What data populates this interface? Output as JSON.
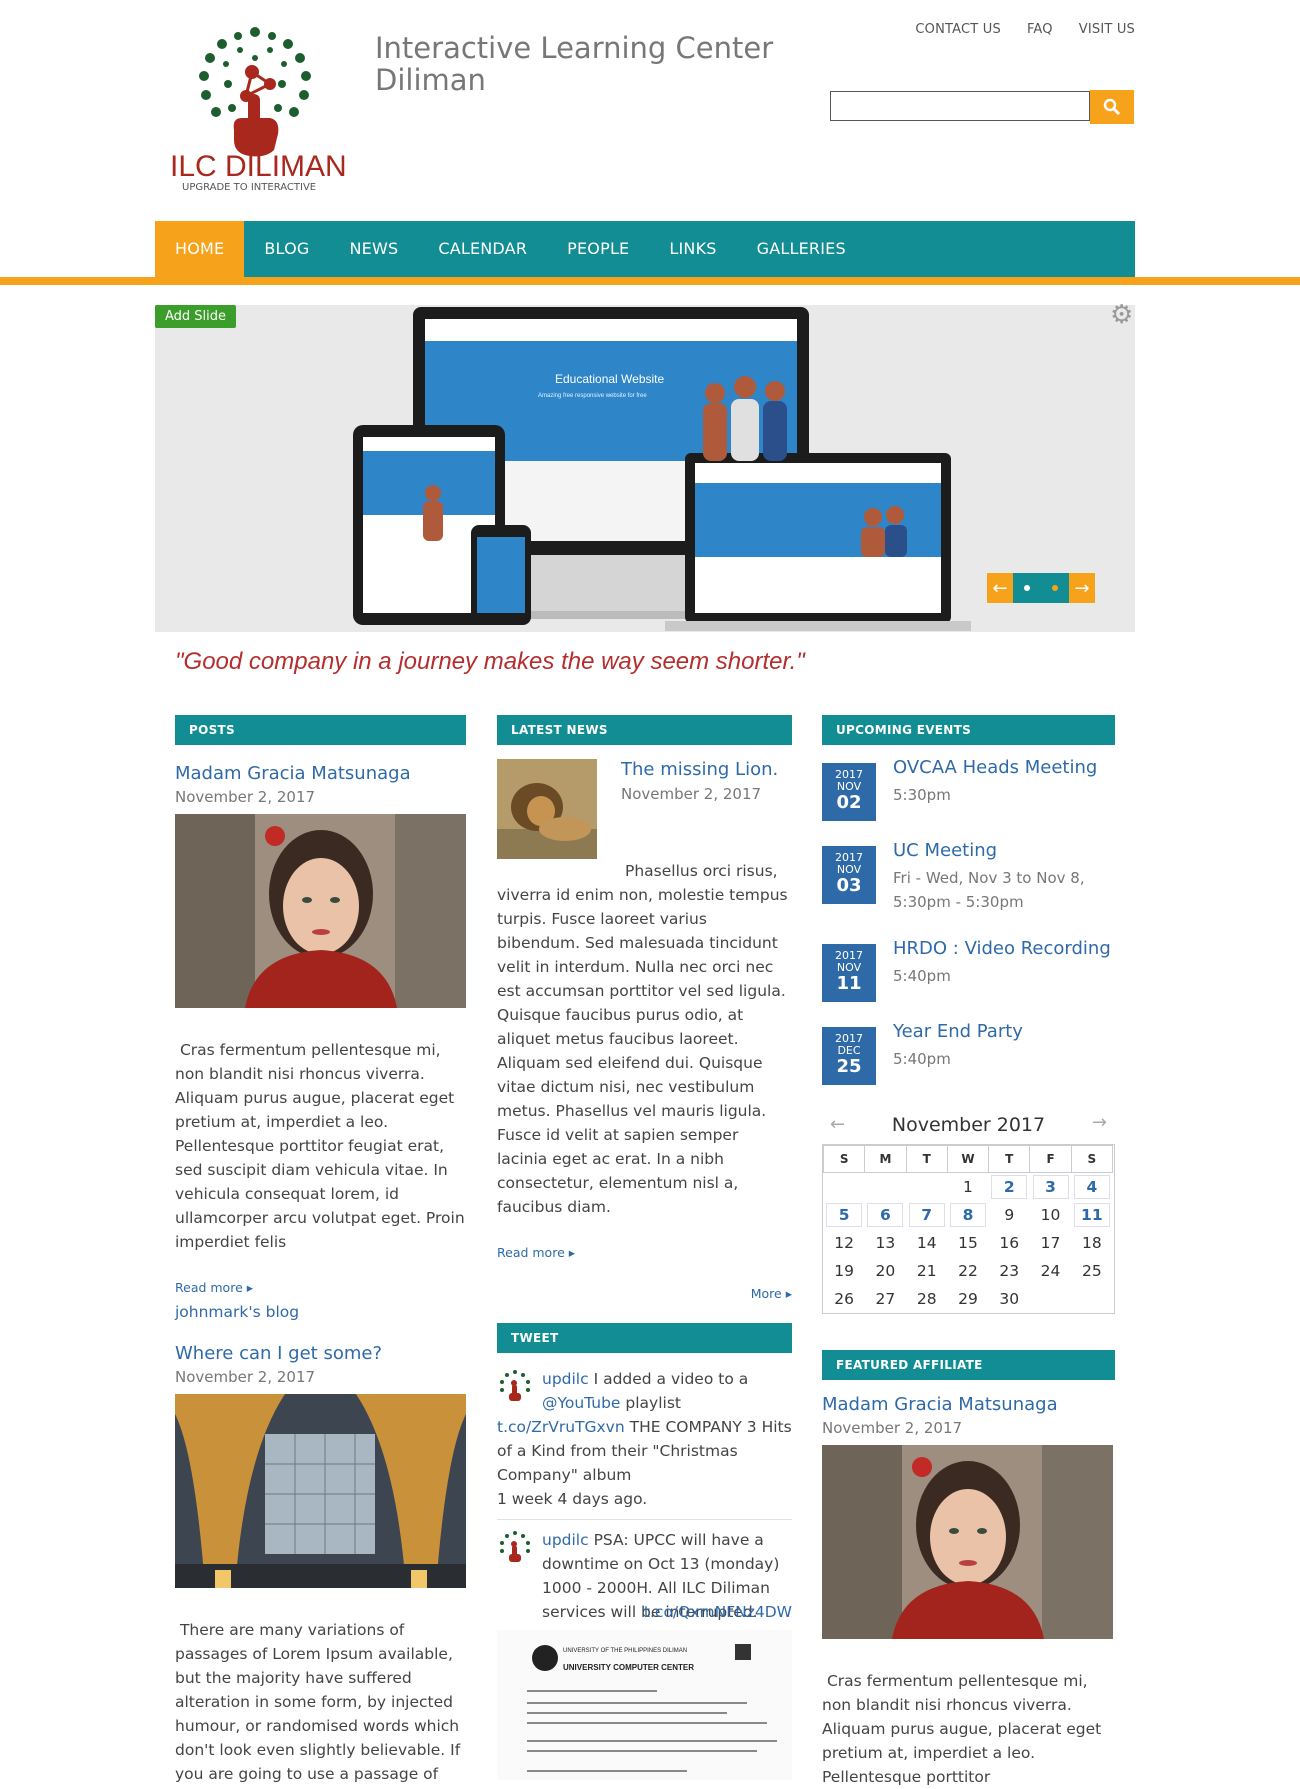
{
  "site": {
    "logo_text": "ILC DILIMAN",
    "logo_tagline": "UPGRADE TO INTERACTIVE",
    "title_line1": "Interactive Learning Center",
    "title_line2": "Diliman"
  },
  "toplinks": [
    "CONTACT US",
    "FAQ",
    "VISIT US"
  ],
  "search": {
    "placeholder": ""
  },
  "nav": [
    "HOME",
    "BLOG",
    "NEWS",
    "CALENDAR",
    "PEOPLE",
    "LINKS",
    "GALLERIES"
  ],
  "slider": {
    "add_slide": "Add Slide",
    "screen_title": "Educational Website",
    "screen_sub": "Amazing free responsive website for free"
  },
  "quote": {
    "text": "Good company in a journey makes the way seem shorter."
  },
  "posts": {
    "heading": "POSTS",
    "items": [
      {
        "title": "Madam Gracia Matsunaga",
        "date": "November 2, 2017",
        "text": "Cras fermentum pellentesque mi, non blandit nisi rhoncus viverra. Aliquam purus augue, placerat eget pretium at, imperdiet a leo. Pellentesque porttitor feugiat erat, sed suscipit diam vehicula vitae. In vehicula consequat lorem, id ullamcorper arcu volutpat eget. Proin imperdiet felis",
        "readmore": "Read more",
        "blog": "johnmark's blog"
      },
      {
        "title": "Where can I get some?",
        "date": "November 2, 2017",
        "text": "There are many variations of passages of Lorem Ipsum available, but the majority have suffered alteration in some form, by injected humour, or randomised words which don't look even slightly believable. If you are going to use a passage of"
      }
    ]
  },
  "news": {
    "heading": "LATEST NEWS",
    "title": "The missing Lion.",
    "date": "November 2, 2017",
    "text": "Phasellus orci risus, viverra id enim non, molestie tempus turpis. Fusce laoreet varius bibendum. Sed malesuada tincidunt velit in interdum. Nulla nec orci nec est accumsan porttitor vel sed ligula. Quisque faucibus purus odio, at aliquet metus faucibus laoreet. Aliquam sed eleifend dui. Quisque vitae dictum nisi, nec vestibulum metus. Phasellus vel mauris ligula. Fusce id velit at sapien semper lacinia eget ac erat. In a nibh consectetur, elementum nisl a, faucibus diam.",
    "readmore": "Read more",
    "more": "More"
  },
  "tweet": {
    "heading": "TWEET",
    "items": [
      {
        "user": "updilc",
        "text1": "I added a video to a",
        "mention": "@YouTube",
        "text2": "playlist",
        "link": "t.co/ZrVruTGxvn",
        "text3": "THE COMPANY 3 Hits of a Kind from their \"Christmas Company\" album",
        "ago": "1 week 4 days ago."
      },
      {
        "user": "updilc",
        "text1": "PSA: UPCC will have a downtime on Oct 13 (monday) 1000 - 2000H. All ILC Diliman services will be interrupted.",
        "link": "t.co/QxmNFNz4DW",
        "doc_header": "UNIVERSITY OF THE PHILIPPINES DILIMAN",
        "doc_center": "UNIVERSITY COMPUTER CENTER"
      }
    ]
  },
  "events": {
    "heading": "UPCOMING EVENTS",
    "items": [
      {
        "year": "2017",
        "month": "NOV",
        "day": "02",
        "title": "OVCAA Heads Meeting",
        "time": "5:30pm"
      },
      {
        "year": "2017",
        "month": "NOV",
        "day": "03",
        "title": "UC Meeting",
        "time": "Fri - Wed, Nov 3 to Nov 8, 5:30pm - 5:30pm"
      },
      {
        "year": "2017",
        "month": "NOV",
        "day": "11",
        "title": "HRDO : Video Recording",
        "time": "5:40pm"
      },
      {
        "year": "2017",
        "month": "DEC",
        "day": "25",
        "title": "Year End Party",
        "time": "5:40pm"
      }
    ]
  },
  "calendar": {
    "title": "November 2017",
    "weekdays": [
      "S",
      "M",
      "T",
      "W",
      "T",
      "F",
      "S"
    ],
    "weeks": [
      [
        "",
        "",
        "",
        "1",
        "2",
        "3",
        "4"
      ],
      [
        "5",
        "6",
        "7",
        "8",
        "9",
        "10",
        "11"
      ],
      [
        "12",
        "13",
        "14",
        "15",
        "16",
        "17",
        "18"
      ],
      [
        "19",
        "20",
        "21",
        "22",
        "23",
        "24",
        "25"
      ],
      [
        "26",
        "27",
        "28",
        "29",
        "30",
        "",
        ""
      ]
    ],
    "event_days": [
      "2",
      "3",
      "4",
      "5",
      "6",
      "7",
      "8",
      "11"
    ]
  },
  "affiliate": {
    "heading": "FEATURED AFFILIATE",
    "title": "Madam Gracia Matsunaga",
    "date": "November 2, 2017",
    "text": "Cras fermentum pellentesque mi, non blandit nisi rhoncus viverra. Aliquam purus augue, placerat eget pretium at, imperdiet a leo. Pellentesque porttitor"
  },
  "colors": {
    "teal": "#128d93",
    "orange": "#f7a21b",
    "link": "#2f6aa8",
    "quote": "#b52d2d",
    "logo_green": "#1d5e2e",
    "logo_red": "#a8281d"
  }
}
